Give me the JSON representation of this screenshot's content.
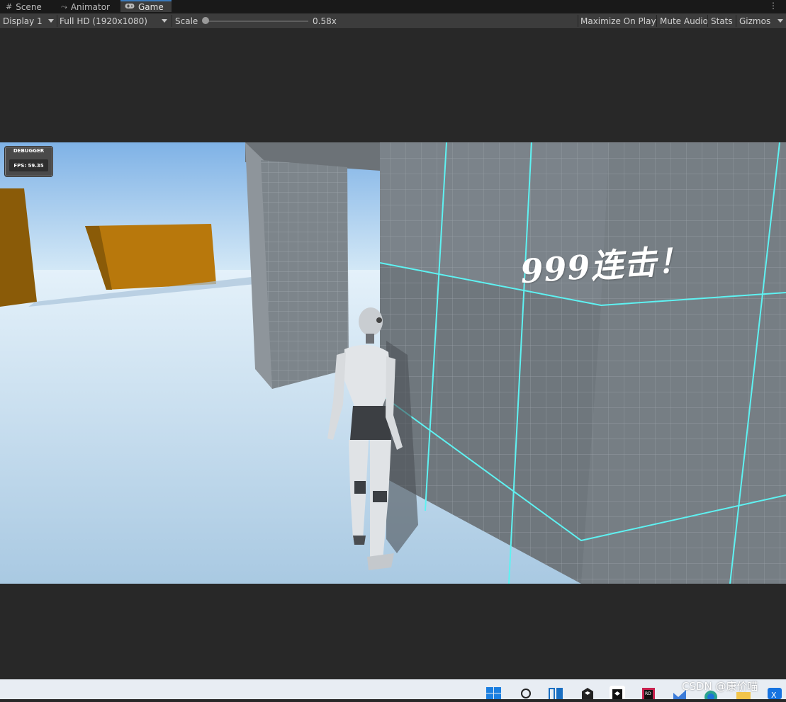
{
  "tabs": [
    {
      "label": "Scene",
      "icon": "grid-icon"
    },
    {
      "label": "Animator",
      "icon": "animator-icon"
    },
    {
      "label": "Game",
      "icon": "gamepad-icon"
    }
  ],
  "toolbar": {
    "display": "Display 1",
    "resolution": "Full HD (1920x1080)",
    "scale_label": "Scale",
    "scale_value": "0.58x",
    "maximize": "Maximize On Play",
    "mute": "Mute Audio",
    "stats": "Stats",
    "gizmos": "Gizmos"
  },
  "game": {
    "debugger_title": "DEBUGGER",
    "fps": "FPS: 59.35",
    "combo_text": "999连击！"
  },
  "taskbar": {
    "icons": [
      "windows-start-icon",
      "search-icon",
      "task-view-icon",
      "unity-hub-icon",
      "unity-editor-icon",
      "rider-icon",
      "visual-studio-icon",
      "edge-icon",
      "file-explorer-icon",
      "app-icon"
    ]
  },
  "watermark": "CSDN @康价喵",
  "colors": {
    "accent": "#3a79bb",
    "grid_line": "#5ef2f2",
    "crate": "#b8780c"
  }
}
